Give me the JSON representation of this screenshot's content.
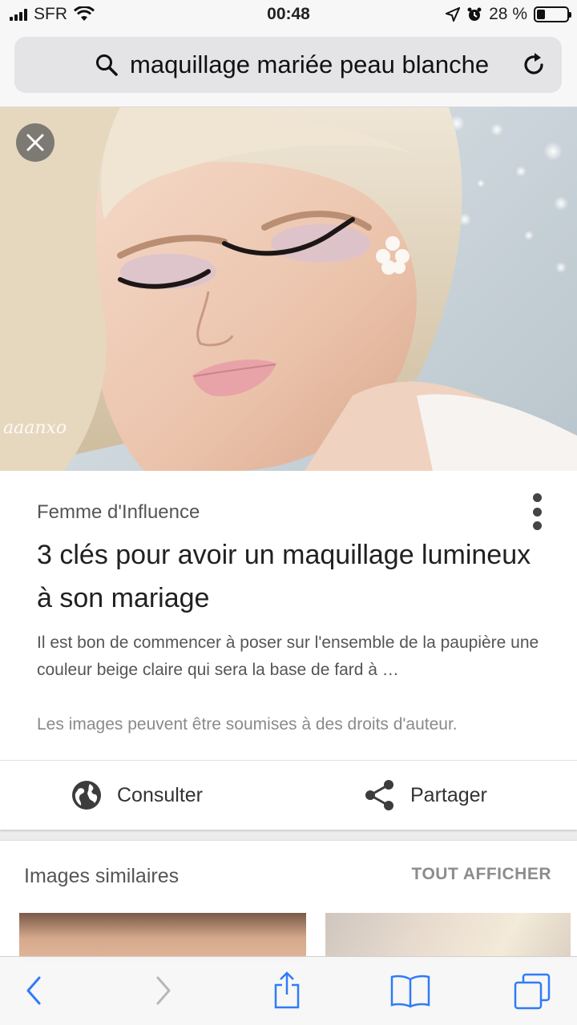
{
  "status_bar": {
    "carrier": "SFR",
    "time": "00:48",
    "battery_percent": "28 %",
    "battery_level": 0.28
  },
  "url_bar": {
    "query": "maquillage mariée peau blanche"
  },
  "hero": {
    "watermark": "aaanxo"
  },
  "card": {
    "source": "Femme d'Influence",
    "title": "3 clés pour avoir un maquillage lumineux à son mariage",
    "snippet": "Il est bon de commencer à poser sur l'ensemble de la paupière une couleur beige claire qui sera la base de fard à …",
    "copyright": "Les images peuvent être soumises à des droits d'auteur.",
    "actions": {
      "consult_label": "Consulter",
      "share_label": "Partager"
    }
  },
  "similar": {
    "title": "Images similaires",
    "show_all": "TOUT AFFICHER"
  },
  "icons": {
    "search": "search-icon",
    "reload": "reload-icon",
    "close": "close-icon",
    "more": "more-vertical-icon",
    "globe": "globe-icon",
    "share": "share-icon",
    "back": "chevron-left-icon",
    "forward": "chevron-right-icon",
    "share_sheet": "share-sheet-icon",
    "bookmarks": "book-icon",
    "tabs": "tabs-icon"
  },
  "colors": {
    "accent": "#1a73e8",
    "ios_blue": "#2f7cf6"
  }
}
